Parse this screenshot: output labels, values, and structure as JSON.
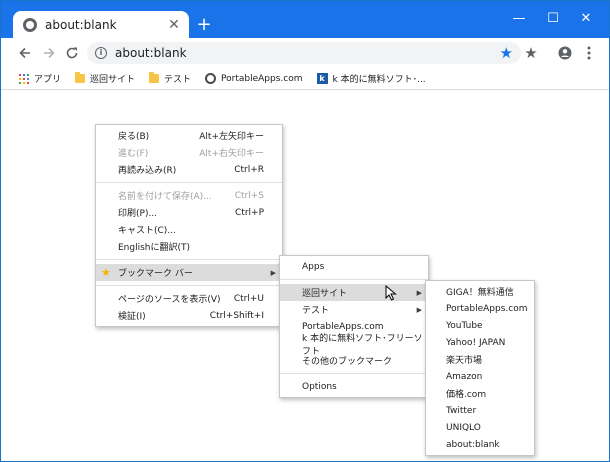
{
  "tab": {
    "title": "about:blank",
    "close": "✕",
    "new_tab": "+"
  },
  "window_controls": {
    "minimize": "—",
    "maximize": "☐",
    "close": "✕"
  },
  "omnibox": {
    "url": "about:blank"
  },
  "bookmarks_bar": {
    "items": [
      {
        "label": "アプリ",
        "icon": "apps-grid-icon"
      },
      {
        "label": "巡回サイト",
        "icon": "folder-icon"
      },
      {
        "label": "テスト",
        "icon": "folder-icon"
      },
      {
        "label": "PortableApps.com",
        "icon": "portableapps-icon"
      },
      {
        "label": "k 本的に無料ソフト･...",
        "icon": "k-icon"
      }
    ]
  },
  "context_menu": {
    "items": [
      {
        "label": "戻る(B)",
        "shortcut": "Alt+左矢印キー",
        "disabled": false
      },
      {
        "label": "進む(F)",
        "shortcut": "Alt+右矢印キー",
        "disabled": true
      },
      {
        "label": "再読み込み(R)",
        "shortcut": "Ctrl+R",
        "disabled": false
      },
      {
        "label": "名前を付けて保存(A)...",
        "shortcut": "Ctrl+S",
        "disabled": true
      },
      {
        "label": "印刷(P)...",
        "shortcut": "Ctrl+P",
        "disabled": false
      },
      {
        "label": "キャスト(C)...",
        "shortcut": "",
        "disabled": false
      },
      {
        "label": "Englishに翻訳(T)",
        "shortcut": "",
        "disabled": false
      },
      {
        "label": "ブックマーク バー",
        "shortcut": "",
        "disabled": false
      },
      {
        "label": "ページのソースを表示(V)",
        "shortcut": "Ctrl+U",
        "disabled": false
      },
      {
        "label": "検証(I)",
        "shortcut": "Ctrl+Shift+I",
        "disabled": false
      }
    ]
  },
  "bookmark_submenu": {
    "items": [
      {
        "label": "Apps"
      },
      {
        "label": "巡回サイト"
      },
      {
        "label": "テスト"
      },
      {
        "label": "PortableApps.com"
      },
      {
        "label": "k 本的に無料ソフト･フリーソフト"
      },
      {
        "label": "その他のブックマーク"
      },
      {
        "label": "Options"
      }
    ]
  },
  "patrol_submenu": {
    "items": [
      {
        "label": "GIGA！無料通信"
      },
      {
        "label": "PortableApps.com"
      },
      {
        "label": "YouTube"
      },
      {
        "label": "Yahoo! JAPAN"
      },
      {
        "label": "楽天市場"
      },
      {
        "label": "Amazon"
      },
      {
        "label": "価格.com"
      },
      {
        "label": "Twitter"
      },
      {
        "label": "UNIQLO"
      },
      {
        "label": "about:blank"
      }
    ]
  },
  "colors": {
    "titlebar": "#1a73e8",
    "highlight": "#dcdcdc",
    "star_bookmark": "#1a73e8",
    "star_menu": "#f4b400"
  }
}
